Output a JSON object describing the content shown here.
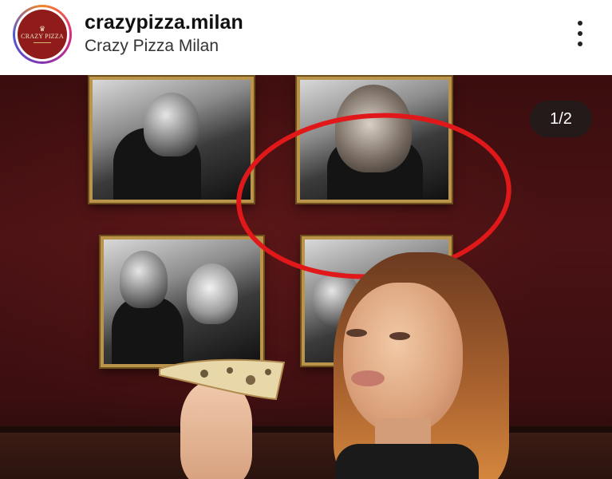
{
  "header": {
    "username": "crazypizza.milan",
    "subtitle": "Crazy Pizza Milan",
    "avatar": {
      "logo_text": "CRAZY PIZZA",
      "crown_icon": "crown-icon"
    },
    "more_icon": "more-vertical-icon"
  },
  "media": {
    "counter": "1/2",
    "annotation_color": "#e0181a",
    "frame_color": "#b9944a",
    "wall_color": "#4a1214"
  }
}
